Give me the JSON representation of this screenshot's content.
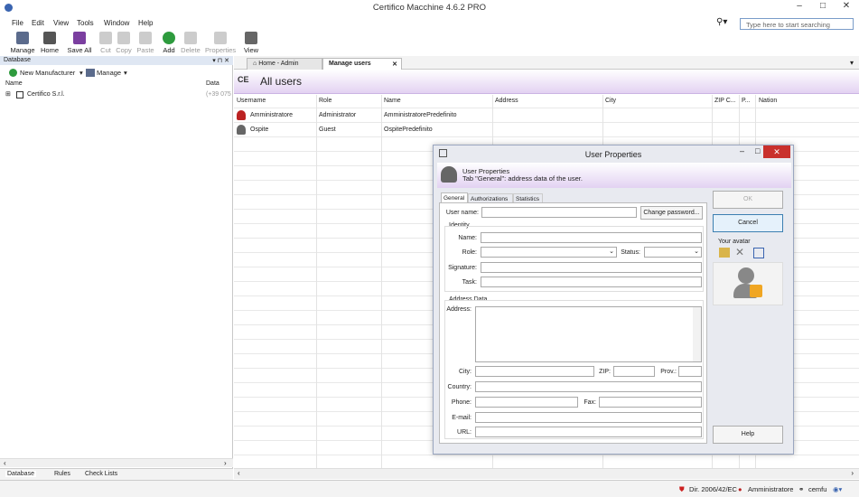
{
  "app": {
    "title": "Certifico Macchine 4.6.2 PRO",
    "search_placeholder": "Type here to start searching"
  },
  "menu": [
    "File",
    "Edit",
    "View",
    "Tools",
    "Window",
    "Help"
  ],
  "toolbar": [
    {
      "label": "Manage",
      "enabled": true
    },
    {
      "label": "Home",
      "enabled": true
    },
    {
      "label": "Save All",
      "enabled": true
    },
    {
      "label": "Cut",
      "enabled": false
    },
    {
      "label": "Copy",
      "enabled": false
    },
    {
      "label": "Paste",
      "enabled": false
    },
    {
      "label": "Add",
      "enabled": true
    },
    {
      "label": "Delete",
      "enabled": false
    },
    {
      "label": "Properties",
      "enabled": false
    },
    {
      "label": "View",
      "enabled": true
    }
  ],
  "left": {
    "title": "Database",
    "new_manufacturer": "New Manufacturer",
    "manage": "Manage",
    "col_name": "Name",
    "col_data": "Data",
    "tree": [
      {
        "name": "Certifico S.r.l.",
        "data": "(+39 075"
      }
    ],
    "tabs": [
      "Database",
      "Rules",
      "Check Lists"
    ]
  },
  "tabs": [
    {
      "label": "Home - Admin"
    },
    {
      "label": "Manage users"
    }
  ],
  "main": {
    "title": "All users",
    "columns": [
      "Username",
      "Role",
      "Name",
      "Address",
      "City",
      "ZIP C...",
      "P...",
      "Nation"
    ],
    "rows": [
      {
        "username": "Amministratore",
        "role": "Administrator",
        "name": "AmministratorePredefinito"
      },
      {
        "username": "Ospite",
        "role": "Guest",
        "name": "OspitePredefinito"
      }
    ]
  },
  "dialog": {
    "title": "User Properties",
    "header_title": "User Properties",
    "header_sub": "Tab \"General\": address data of the user.",
    "tabs": [
      "General",
      "Authorizations",
      "Statistics"
    ],
    "user_name": "User name:",
    "change_password": "Change password...",
    "identity": "Identity",
    "name": "Name:",
    "role": "Role:",
    "status": "Status:",
    "signature": "Signature:",
    "task": "Task:",
    "address_data": "Address Data",
    "address": "Address:",
    "city": "City:",
    "zip": "ZIP:",
    "prov": "Prov.:",
    "country": "Country:",
    "phone": "Phone:",
    "fax": "Fax:",
    "email": "E-mail:",
    "url": "URL:",
    "ok": "OK",
    "cancel": "Cancel",
    "your_avatar": "Your avatar",
    "help": "Help"
  },
  "status": {
    "directive": "Dir. 2006/42/EC",
    "user": "Amministratore",
    "host": "cemfu"
  },
  "colors": {
    "accent": "#e3d2f2",
    "header_blue": "#dfe7f3",
    "close_red": "#c9302c"
  }
}
